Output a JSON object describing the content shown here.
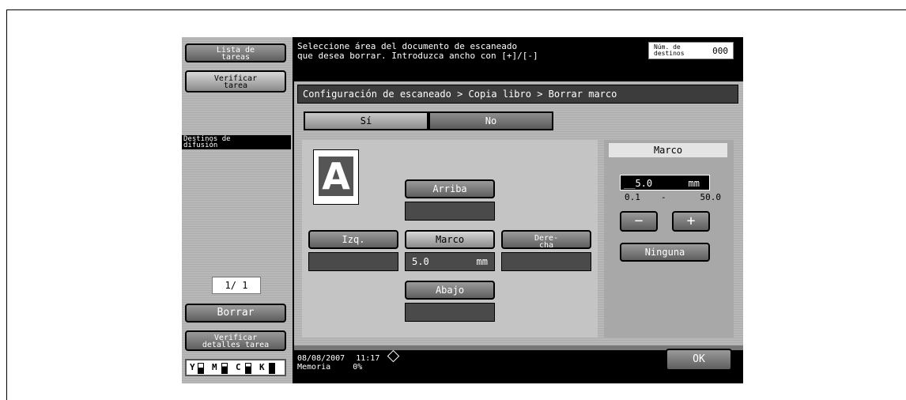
{
  "sidebar": {
    "job_list": "Lista de\ntareas",
    "verify_job": "Verificar\ntarea",
    "broadcast_label": "Destinos de\ndifusión",
    "page_indicator": "1/ 1",
    "delete_btn": "Borrar",
    "verify_details": "Verificar\ndetalles tarea",
    "toner": [
      "Y",
      "M",
      "C",
      "K"
    ]
  },
  "header": {
    "message_line1": "Seleccione área del documento de escaneado",
    "message_line2": "que desea borrar. Introduzca ancho con [+]/[-]",
    "dest_label": "Núm. de\ndestinos",
    "dest_count": "000"
  },
  "breadcrumb": "Configuración de escaneado > Copia libro > Borrar marco",
  "toggle": {
    "yes": "Sí",
    "no": "No"
  },
  "left_panel": {
    "icon_letter": "A",
    "top_btn": "Arriba",
    "left_btn": "Izq.",
    "frame_btn": "Marco",
    "right_btn": "Dere-\ncha",
    "bottom_btn": "Abajo",
    "frame_value": "5.0",
    "frame_unit": "mm"
  },
  "right_panel": {
    "title": "Marco",
    "value": "__5.0",
    "unit": "mm",
    "range_min": "0.1",
    "range_sep": "-",
    "range_max": "50.0",
    "minus": "−",
    "plus": "+",
    "none_btn": "Ninguna"
  },
  "footer": {
    "date": "08/08/2007",
    "time": "11:17",
    "memory_label": "Memoria",
    "memory_value": "0%",
    "ok_btn": "OK"
  },
  "colors": {
    "screen_bg": "#000000",
    "panel": "#b8b8b8",
    "button_dark": "#5e5e5e"
  }
}
